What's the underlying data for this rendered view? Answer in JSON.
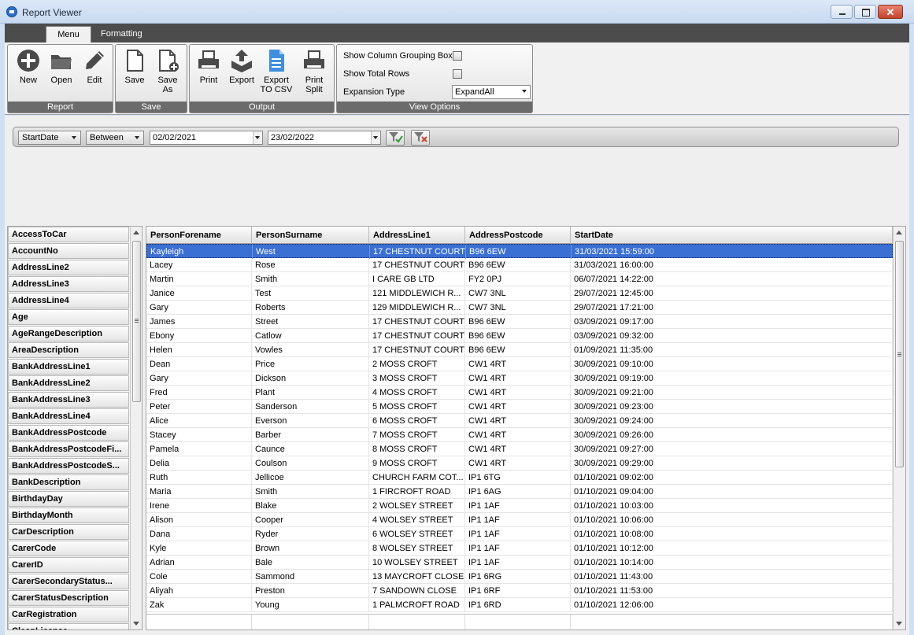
{
  "window": {
    "title": "Report Viewer"
  },
  "ribbon": {
    "tabs": [
      "Menu",
      "Formatting"
    ],
    "report": {
      "label": "Report",
      "new": "New",
      "open": "Open",
      "edit": "Edit"
    },
    "save": {
      "label": "Save",
      "save": "Save",
      "save_as_1": "Save",
      "save_as_2": "As"
    },
    "output": {
      "label": "Output",
      "print": "Print",
      "export": "Export",
      "export_csv_1": "Export",
      "export_csv_2": "TO CSV",
      "print_split_1": "Print",
      "print_split_2": "Split"
    },
    "view_options": {
      "label": "View Options",
      "show_column_grouping_box": "Show Column Grouping Box",
      "show_total_rows": "Show Total Rows",
      "expansion_type_label": "Expansion Type",
      "expansion_type_value": "ExpandAll"
    }
  },
  "filter": {
    "field": "StartDate",
    "operator": "Between",
    "from": "02/02/2021",
    "to": "23/02/2022"
  },
  "fields": [
    "AccessToCar",
    "AccountNo",
    "AddressLine2",
    "AddressLine3",
    "AddressLine4",
    "Age",
    "AgeRangeDescription",
    "AreaDescription",
    "BankAddressLine1",
    "BankAddressLine2",
    "BankAddressLine3",
    "BankAddressLine4",
    "BankAddressPostcode",
    "BankAddressPostcodeFi...",
    "BankAddressPostcodeS...",
    "BankDescription",
    "BirthdayDay",
    "BirthdayMonth",
    "CarDescription",
    "CarerCode",
    "CarerID",
    "CarerSecondaryStatus...",
    "CarerStatusDescription",
    "CarRegistration",
    "CleanLicence"
  ],
  "grid": {
    "columns": [
      "PersonForename",
      "PersonSurname",
      "AddressLine1",
      "AddressPostcode",
      "StartDate"
    ],
    "rows": [
      [
        "Kayleigh",
        "West",
        "17 CHESTNUT COURT",
        "B96  6EW",
        "31/03/2021 15:59:00"
      ],
      [
        "Lacey",
        "Rose",
        "17 CHESTNUT COURT",
        "B96  6EW",
        "31/03/2021 16:00:00"
      ],
      [
        "Martin",
        "Smith",
        "I CARE GB LTD",
        "FY2 0PJ",
        "06/07/2021 14:22:00"
      ],
      [
        "Janice",
        "Test",
        "121 MIDDLEWICH R...",
        "CW7 3NL",
        "29/07/2021 12:45:00"
      ],
      [
        "Gary",
        "Roberts",
        "129 MIDDLEWICH R...",
        "CW7 3NL",
        "29/07/2021 17:21:00"
      ],
      [
        "James",
        "Street",
        "17 CHESTNUT COURT",
        "B96 6EW",
        "03/09/2021 09:17:00"
      ],
      [
        "Ebony",
        "Catlow",
        "17 CHESTNUT COURT",
        "B96 6EW",
        "03/09/2021 09:32:00"
      ],
      [
        "Helen",
        "Vowles",
        "17 CHESTNUT COURT",
        "B96  6EW",
        "01/09/2021 11:35:00"
      ],
      [
        "Dean",
        "Price",
        "2 MOSS CROFT",
        "CW1 4RT",
        "30/09/2021 09:10:00"
      ],
      [
        "Gary",
        "Dickson",
        "3 MOSS CROFT",
        "CW1  4RT",
        "30/09/2021 09:19:00"
      ],
      [
        "Fred",
        "Plant",
        "4 MOSS CROFT",
        "CW1 4RT",
        "30/09/2021 09:21:00"
      ],
      [
        "Peter",
        "Sanderson",
        "5 MOSS CROFT",
        "CW1 4RT",
        "30/09/2021 09:23:00"
      ],
      [
        "Alice",
        "Everson",
        "6 MOSS CROFT",
        "CW1 4RT",
        "30/09/2021 09:24:00"
      ],
      [
        "Stacey",
        "Barber",
        "7 MOSS CROFT",
        "CW1 4RT",
        "30/09/2021 09:26:00"
      ],
      [
        "Pamela",
        "Caunce",
        "8 MOSS CROFT",
        "CW1 4RT",
        "30/09/2021 09:27:00"
      ],
      [
        "Delia",
        "Coulson",
        "9 MOSS CROFT",
        "CW1 4RT",
        "30/09/2021 09:29:00"
      ],
      [
        "Ruth",
        "Jellicoe",
        "CHURCH FARM COT...",
        "IP1 6TG",
        "01/10/2021 09:02:00"
      ],
      [
        "Maria",
        "Smith",
        "1 FIRCROFT ROAD",
        "IP1 6AG",
        "01/10/2021 09:04:00"
      ],
      [
        "Irene",
        "Blake",
        "2 WOLSEY STREET",
        "IP1 1AF",
        "01/10/2021 10:03:00"
      ],
      [
        "Alison",
        "Cooper",
        "4 WOLSEY STREET",
        "IP1 1AF",
        "01/10/2021 10:06:00"
      ],
      [
        "Dana",
        "Ryder",
        "6 WOLSEY STREET",
        "IP1 1AF",
        "01/10/2021 10:08:00"
      ],
      [
        "Kyle",
        "Brown",
        "8 WOLSEY STREET",
        "IP1 1AF",
        "01/10/2021 10:12:00"
      ],
      [
        "Adrian",
        "Bale",
        "10 WOLSEY STREET",
        "IP1 1AF",
        "01/10/2021 10:14:00"
      ],
      [
        "Cole",
        "Sammond",
        "13 MAYCROFT CLOSE",
        "IP1 6RG",
        "01/10/2021 11:43:00"
      ],
      [
        "Aliyah",
        "Preston",
        "7 SANDOWN CLOSE",
        "IP1 6RF",
        "01/10/2021 11:53:00"
      ],
      [
        "Zak",
        "Young",
        "1 PALMCROFT ROAD",
        "IP1 6RD",
        "01/10/2021 12:06:00"
      ]
    ]
  },
  "colors": {
    "selection": "#3a6fd3",
    "ribbon_group_label": "#6b6b6b",
    "tab_strip": "#4c4c4c"
  }
}
